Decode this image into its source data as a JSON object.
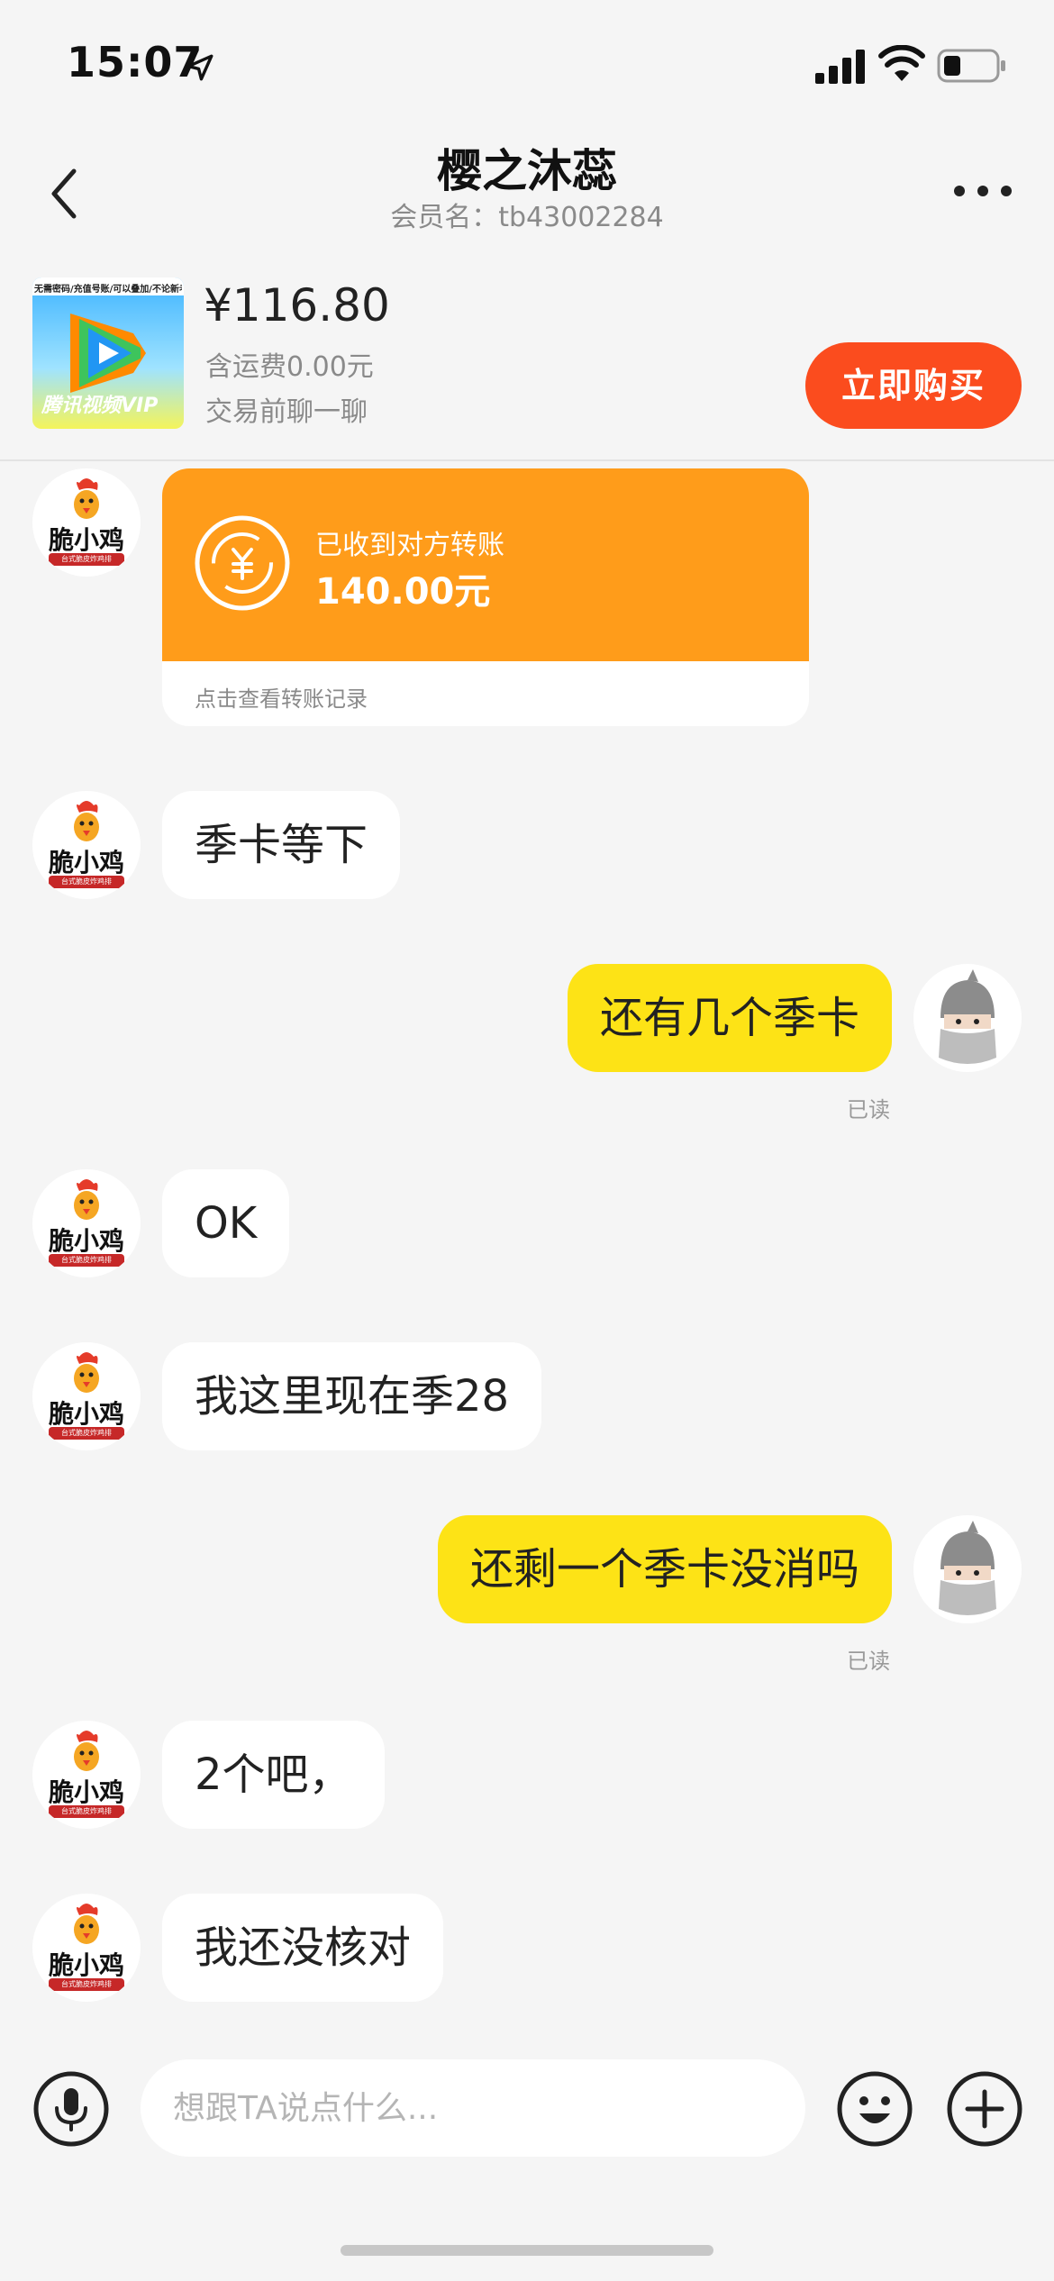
{
  "status_bar": {
    "time": "15:07"
  },
  "header": {
    "title": "樱之沐蕊",
    "subtitle": "会员名：tb43002284"
  },
  "product": {
    "thumb_brand": "腾讯视频VIP",
    "thumb_banner": "无需密码/充值号账/可以叠加/不论新老",
    "price": "¥116.80",
    "shipping": "含运费0.00元",
    "note": "交易前聊一聊",
    "buy_label": "立即购买"
  },
  "seller_avatar": {
    "text": "脆小鸡",
    "sub": "台式脆皮炸鸡排"
  },
  "transfer": {
    "label": "已收到对方转账",
    "amount": "140.00元",
    "link": "点击查看转账记录"
  },
  "messages": [
    {
      "sender": "seller",
      "text": "季卡等下"
    },
    {
      "sender": "me",
      "text": "还有几个季卡",
      "receipt": "已读"
    },
    {
      "sender": "seller",
      "text": "OK"
    },
    {
      "sender": "seller",
      "text": "我这里现在季28"
    },
    {
      "sender": "me",
      "text": "还剩一个季卡没消吗",
      "receipt": "已读"
    },
    {
      "sender": "seller",
      "text": "2个吧，"
    },
    {
      "sender": "seller",
      "text": "我还没核对"
    }
  ],
  "input": {
    "placeholder": "想跟TA说点什么..."
  },
  "colors": {
    "accent": "#fb4c1e",
    "outgoing_bubble": "#fde316",
    "transfer": "#ff9c1a"
  }
}
